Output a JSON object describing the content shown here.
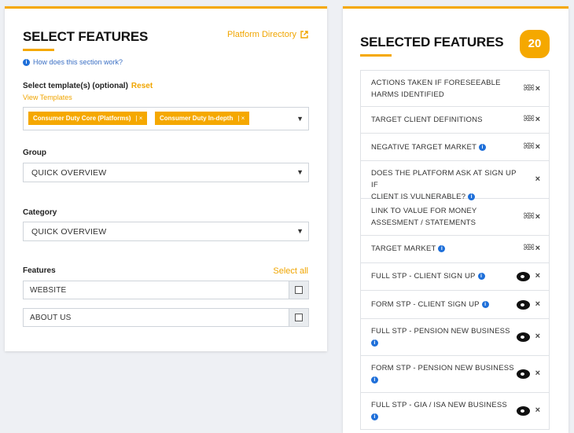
{
  "left": {
    "title": "SELECT FEATURES",
    "platform_link": "Platform Directory",
    "help_text": "How does this section work?",
    "template_label": "Select template(s) (optional)",
    "reset_label": "Reset",
    "view_templates": "View Templates",
    "templates": [
      "Consumer Duty Core (Platforms)",
      "Consumer Duty In-depth"
    ],
    "group_label": "Group",
    "group_value": "QUICK OVERVIEW",
    "category_label": "Category",
    "category_value": "QUICK OVERVIEW",
    "features_label": "Features",
    "select_all": "Select all",
    "features": [
      "WEBSITE",
      "ABOUT US"
    ]
  },
  "right": {
    "title": "SELECTED FEATURES",
    "count": "20",
    "items": [
      {
        "line1": "ACTIONS TAKEN IF FORESEEABLE",
        "line2": "HARMS IDENTIFIED",
        "info": false,
        "icon": "people-icon"
      },
      {
        "line1": "TARGET CLIENT DEFINITIONS",
        "line2": "",
        "info": false,
        "icon": "people-icon"
      },
      {
        "line1": "NEGATIVE TARGET MARKET",
        "line2": "",
        "info": true,
        "icon": "people-icon"
      },
      {
        "line1": "DOES THE PLATFORM ASK AT SIGN UP IF",
        "line2": "CLIENT IS VULNERABLE?",
        "info": true,
        "icon": "none"
      },
      {
        "line1": "LINK TO VALUE FOR MONEY",
        "line2": "ASSESMENT / STATEMENTS",
        "info": false,
        "icon": "people-icon"
      },
      {
        "line1": "TARGET MARKET",
        "line2": "",
        "info": true,
        "icon": "people-icon"
      },
      {
        "line1": "FULL STP - CLIENT SIGN UP",
        "line2": "",
        "info": true,
        "icon": "eye-icon"
      },
      {
        "line1": "FORM STP - CLIENT SIGN UP",
        "line2": "",
        "info": true,
        "icon": "eye-icon"
      },
      {
        "line1": "FULL STP - PENSION NEW BUSINESS",
        "line2": "",
        "info": true,
        "icon": "eye-icon"
      },
      {
        "line1": "FORM STP - PENSION NEW BUSINESS",
        "line2": "",
        "info": true,
        "icon": "eye-icon"
      },
      {
        "line1": "FULL STP - GIA / ISA NEW BUSINESS",
        "line2": "",
        "info": true,
        "icon": "eye-icon"
      }
    ]
  },
  "colors": {
    "accent": "#f5a800",
    "info": "#1e6fd9"
  }
}
